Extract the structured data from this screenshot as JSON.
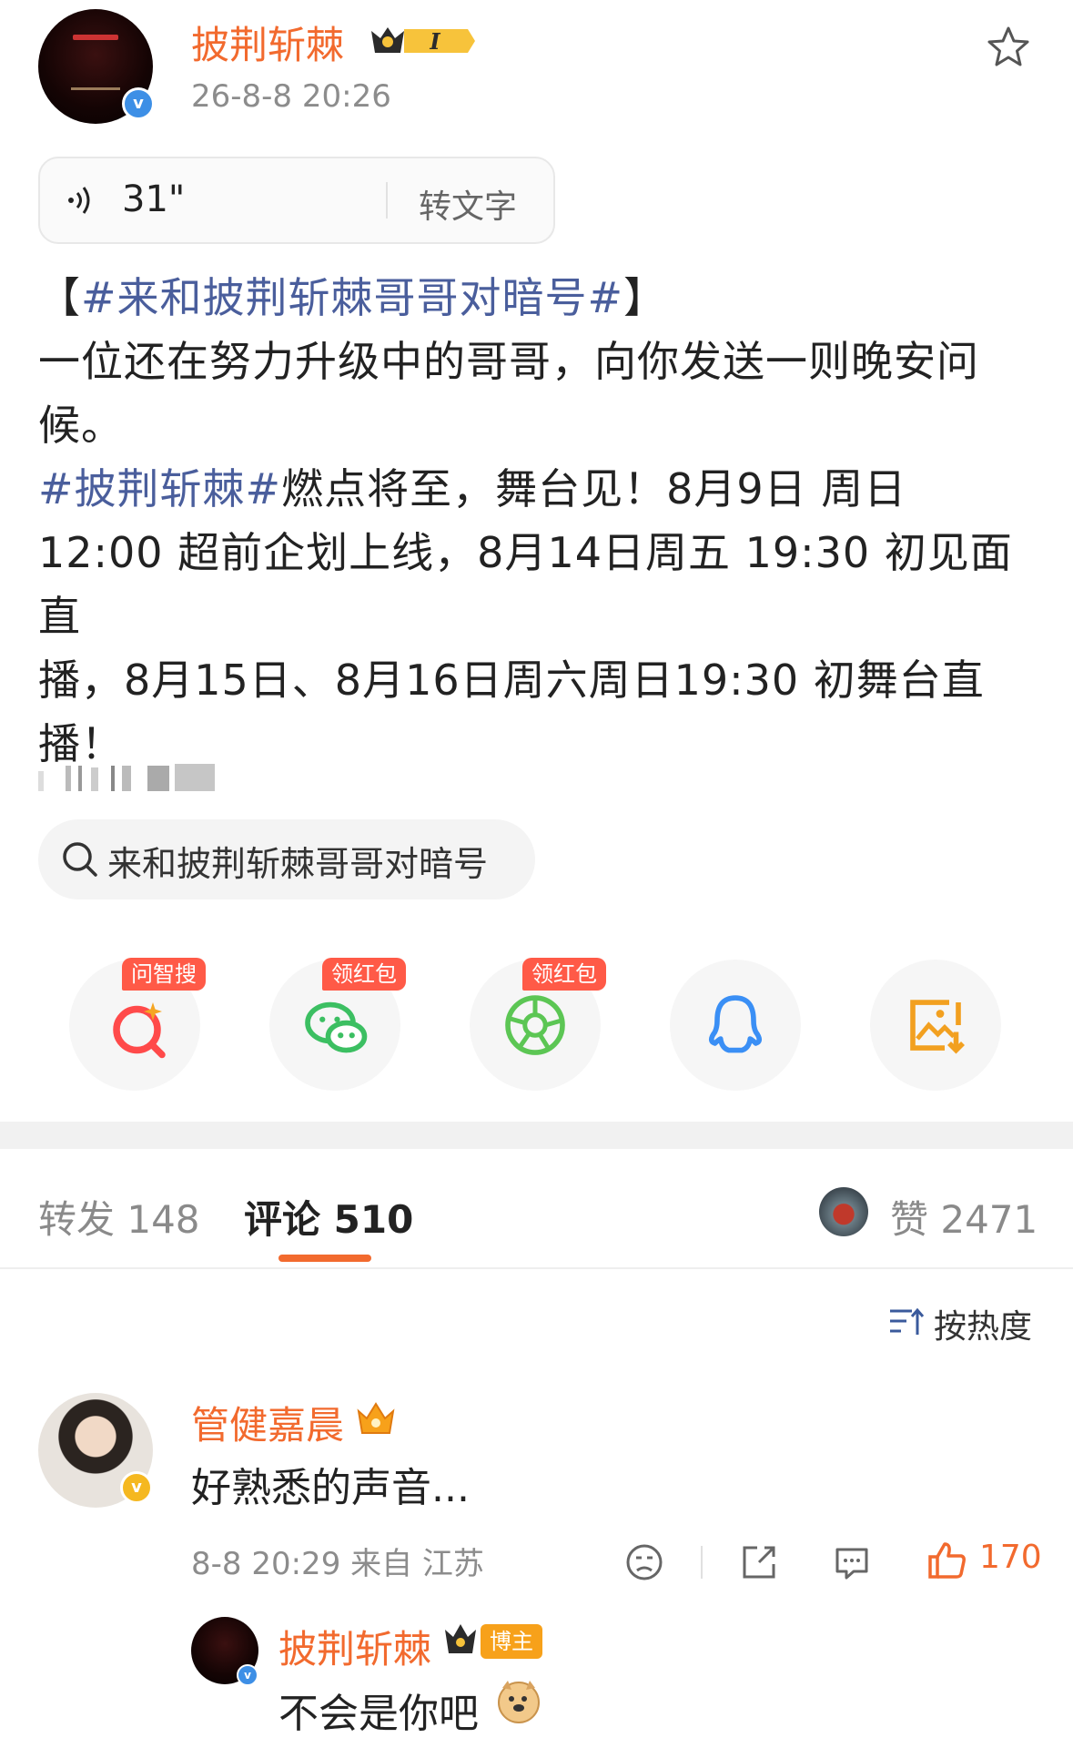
{
  "post": {
    "username": "披荆斩棘",
    "timestamp": "26-8-8 20:26",
    "voice": {
      "duration": "31\"",
      "convert_label": "转文字"
    },
    "text_lines": [
      {
        "parts": [
          {
            "text": "【",
            "link": false
          },
          {
            "text": "#来和披荆斩棘哥哥对暗号#",
            "link": true
          },
          {
            "text": "】",
            "link": false
          }
        ]
      },
      {
        "parts": [
          {
            "text": "一位还在努力升级中的哥哥，向你发送一则晚安问",
            "link": false
          }
        ]
      },
      {
        "parts": [
          {
            "text": "候。",
            "link": false
          }
        ]
      },
      {
        "parts": [
          {
            "text": "#披荆斩棘#",
            "link": true
          },
          {
            "text": "燃点将至，舞台见！8月9日 周日",
            "link": false
          }
        ]
      },
      {
        "parts": [
          {
            "text": "12:00 超前企划上线，8月14日周五 19:30 初见面直",
            "link": false
          }
        ]
      },
      {
        "parts": [
          {
            "text": "播，8月15日、8月16日周六周日19:30 初舞台直",
            "link": false
          }
        ]
      },
      {
        "parts": [
          {
            "text": "播！",
            "link": false
          }
        ]
      }
    ],
    "topic_chip": "来和披荆斩棘哥哥对暗号",
    "crown_badge": "I"
  },
  "share": [
    {
      "name": "zhisou",
      "tag": "问智搜",
      "icon": "smart-search-icon",
      "color": "#ff4a4a"
    },
    {
      "name": "wechat",
      "tag": "领红包",
      "icon": "wechat-icon",
      "color": "#3cbf62"
    },
    {
      "name": "moments",
      "tag": "领红包",
      "icon": "moments-icon",
      "color": "#5cc654"
    },
    {
      "name": "qq",
      "tag": "",
      "icon": "qq-icon",
      "color": "#3a8ff5"
    },
    {
      "name": "save-image",
      "tag": "",
      "icon": "save-image-icon",
      "color": "#f2a020"
    }
  ],
  "tabs": {
    "repost": "转发 148",
    "comments": "评论 510",
    "likes": "赞 2471"
  },
  "sort_label": "按热度",
  "comment": {
    "username": "管健嘉晨",
    "text": "好熟悉的声音...",
    "meta": "8-8 20:29 来自 江苏",
    "like_count": "170",
    "reply": {
      "username": "披荆斩棘",
      "badge": "博主",
      "text": "不会是你吧"
    }
  },
  "colors": {
    "accent": "#f26a2e",
    "link": "#4a5e9c",
    "tag_red": "#ff5a47"
  }
}
